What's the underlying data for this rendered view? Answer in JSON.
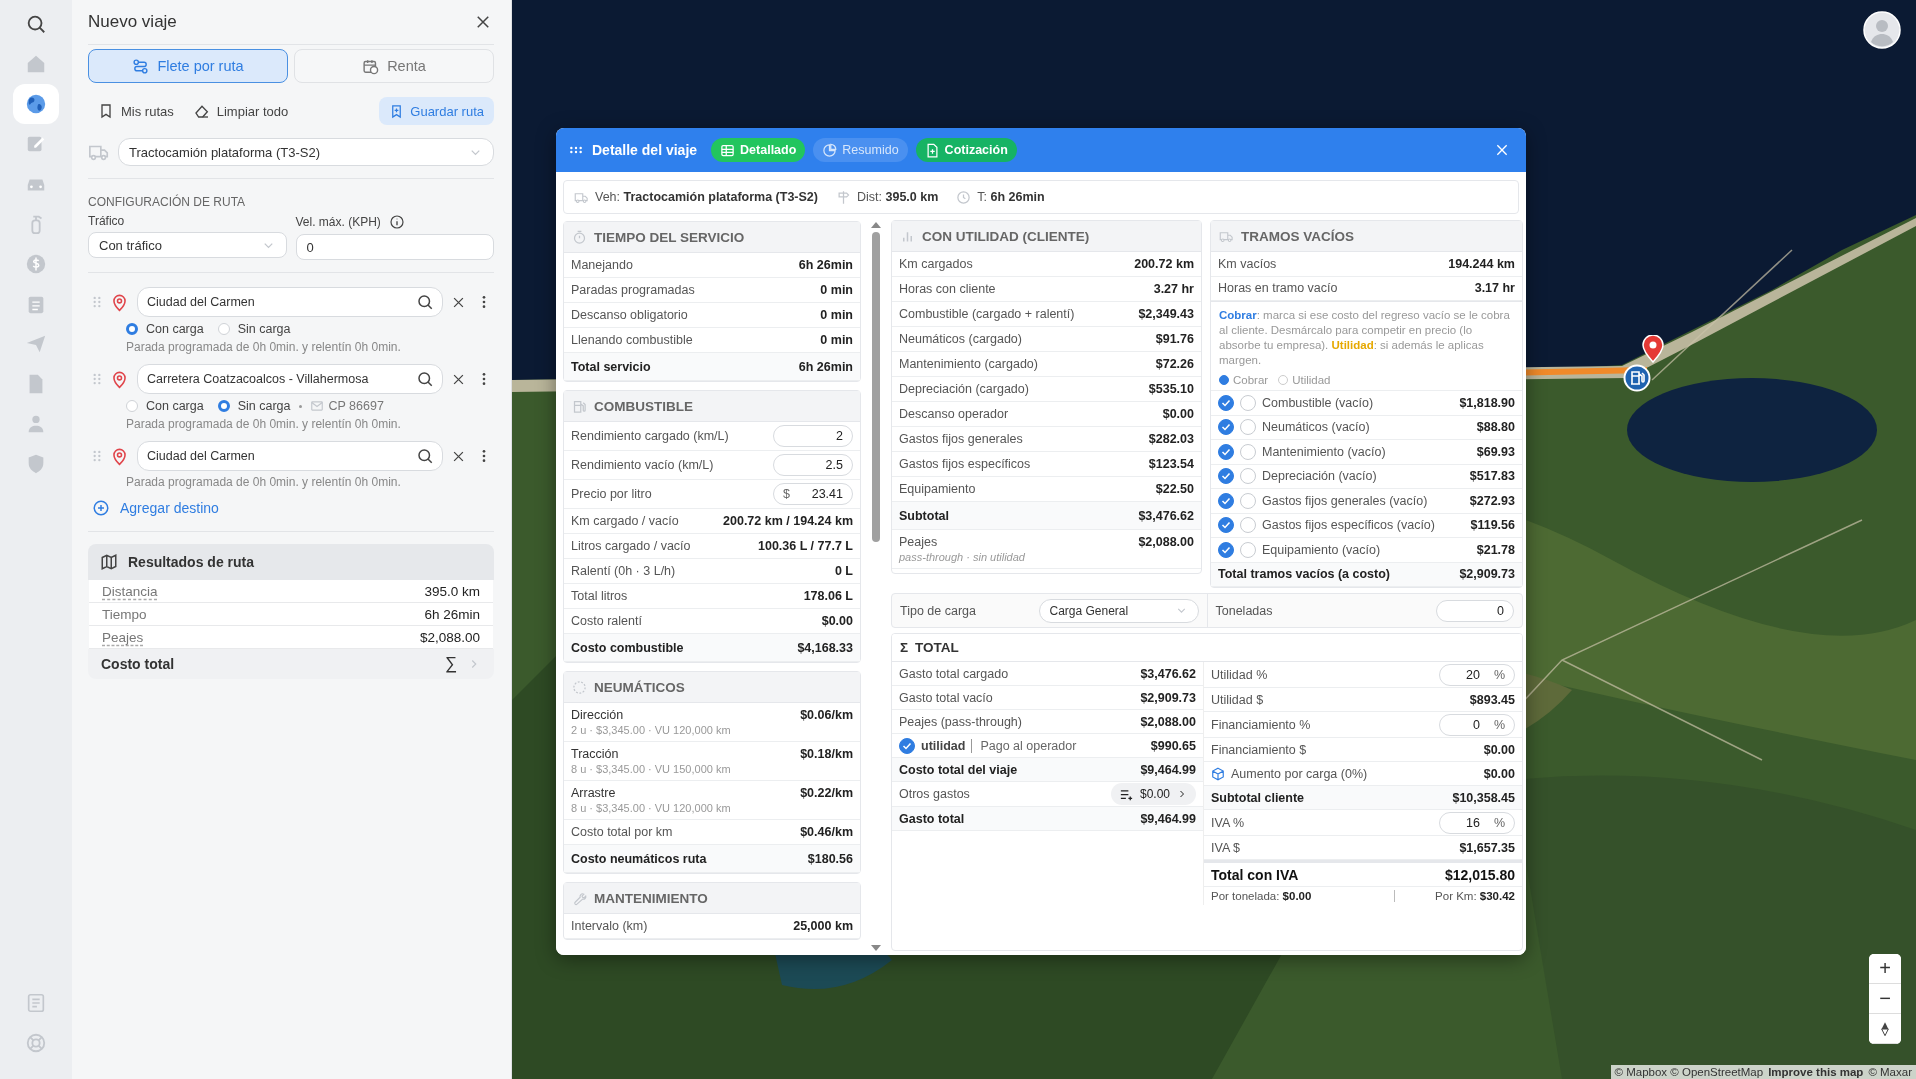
{
  "rail": {
    "top": [
      {
        "selected": false
      },
      {
        "selected": false
      },
      {
        "selected": true
      },
      {
        "selected": false
      },
      {
        "selected": false
      },
      {
        "selected": false
      },
      {
        "selected": false
      },
      {
        "selected": false
      },
      {
        "selected": false
      },
      {
        "selected": false
      },
      {
        "selected": false
      },
      {
        "selected": false
      }
    ],
    "bottom": [
      {
        "selected": false
      },
      {
        "selected": false
      }
    ]
  },
  "panel": {
    "title": "Nuevo viaje",
    "modes": [
      {
        "label": "Flete por ruta",
        "selected": true
      },
      {
        "label": "Renta",
        "selected": false
      }
    ],
    "actions": [
      "Mis rutas",
      "Limpiar todo"
    ],
    "save_button": "Guardar ruta",
    "vehicle": "Tractocamión plataforma (T3-S2)",
    "section_title": "CONFIGURACIÓN DE RUTA",
    "traffic": {
      "label": "Tráfico",
      "value": "Con tráfico"
    },
    "max_speed": {
      "label": "Vel. máx. (KPH)",
      "value": "0"
    },
    "stops": [
      {
        "value": "Ciudad del Carmen",
        "load_options": [
          {
            "label": "Con carga",
            "selected": true
          },
          {
            "label": "Sin carga",
            "selected": false
          }
        ],
        "note": "Parada programada de 0h 0min. y relentín 0h 0min."
      },
      {
        "value": "Carretera Coatzacoalcos - Villahermosa",
        "load_options": [
          {
            "label": "Con carga",
            "selected": false
          },
          {
            "label": "Sin carga",
            "selected": true
          }
        ],
        "postal_code": "CP 86697",
        "note": "Parada programada de 0h 0min. y relentín 0h 0min."
      },
      {
        "value": "Ciudad del Carmen",
        "note": "Parada programada de 0h 0min. y relentín 0h 0min."
      }
    ],
    "add_stop": "Agregar destino",
    "results": {
      "title": "Resultados de ruta",
      "rows": [
        {
          "label": "Distancia",
          "value": "395.0 km",
          "hint": true
        },
        {
          "label": "Tiempo",
          "value": "6h 26min",
          "hint": false
        },
        {
          "label": "Peajes",
          "value": "$2,088.00",
          "hint": true
        }
      ],
      "total_label": "Costo total",
      "symbol": "∑"
    }
  },
  "trip_detail": {
    "title": "Detalle del viaje",
    "views": [
      {
        "label": "Detallado",
        "selected": true
      },
      {
        "label": "Resumido",
        "selected": false
      }
    ],
    "quote_button": "Cotización",
    "summary": [
      {
        "label": "Veh:",
        "value": "Tractocamión plataforma (T3-S2)"
      },
      {
        "label": "Dist:",
        "value": "395.0 km"
      },
      {
        "label": "T:",
        "value": "6h 26min"
      }
    ],
    "left_sections": [
      {
        "title": "TIEMPO DEL SERVICIO",
        "rows": [
          {
            "kind": "row",
            "label": "Manejando",
            "value": "6h 26min"
          },
          {
            "kind": "row",
            "label": "Paradas programadas",
            "value": "0 min"
          },
          {
            "kind": "row",
            "label": "Descanso obligatorio",
            "value": "0 min"
          },
          {
            "kind": "row",
            "label": "Llenando combustible",
            "value": "0 min"
          },
          {
            "kind": "total",
            "label": "Total servicio",
            "value": "6h 26min"
          }
        ]
      },
      {
        "title": "COMBUSTIBLE",
        "rows": [
          {
            "kind": "input",
            "label": "Rendimiento cargado (km/L)",
            "value": "2"
          },
          {
            "kind": "input",
            "label": "Rendimiento vacío (km/L)",
            "value": "2.5"
          },
          {
            "kind": "input",
            "label": "Precio por litro",
            "value": "23.41",
            "prefix": "$"
          },
          {
            "kind": "row",
            "label": "Km cargado / vacío",
            "value": "200.72 km / 194.24 km"
          },
          {
            "kind": "row",
            "label": "Litros cargado / vacío",
            "value": "100.36 L / 77.7 L"
          },
          {
            "kind": "row",
            "label": "Ralentí (0h · 3 L/h)",
            "value": "0 L"
          },
          {
            "kind": "row",
            "label": "Total litros",
            "value": "178.06 L"
          },
          {
            "kind": "row",
            "label": "Costo ralentí",
            "value": "$0.00"
          },
          {
            "kind": "total",
            "label": "Costo combustible",
            "value": "$4,168.33"
          }
        ]
      },
      {
        "title": "NEUMÁTICOS",
        "rows": [
          {
            "kind": "detail",
            "label": "Dirección",
            "value": "$0.06/km",
            "sub": "2 u · $3,345.00 · VU 120,000 km"
          },
          {
            "kind": "detail",
            "label": "Tracción",
            "value": "$0.18/km",
            "sub": "8 u · $3,345.00 · VU 150,000 km"
          },
          {
            "kind": "detail",
            "label": "Arrastre",
            "value": "$0.22/km",
            "sub": "8 u · $3,345.00 · VU 120,000 km"
          },
          {
            "kind": "row",
            "label": "Costo total por km",
            "value": "$0.46/km"
          },
          {
            "kind": "total",
            "label": "Costo neumáticos ruta",
            "value": "$180.56"
          }
        ]
      },
      {
        "title": "MANTENIMIENTO",
        "rows": [
          {
            "kind": "row",
            "label": "Intervalo (km)",
            "value": "25,000 km"
          }
        ]
      }
    ],
    "client_card": {
      "title": "CON UTILIDAD (CLIENTE)",
      "rows": [
        {
          "kind": "row",
          "label": "Km cargados",
          "value": "200.72 km"
        },
        {
          "kind": "row",
          "label": "Horas con cliente",
          "value": "3.27 hr"
        },
        {
          "kind": "row",
          "label": "Combustible (cargado + ralentí)",
          "value": "$2,349.43"
        },
        {
          "kind": "row",
          "label": "Neumáticos (cargado)",
          "value": "$91.76"
        },
        {
          "kind": "row",
          "label": "Mantenimiento (cargado)",
          "value": "$72.26"
        },
        {
          "kind": "row",
          "label": "Depreciación (cargado)",
          "value": "$535.10"
        },
        {
          "kind": "row",
          "label": "Descanso operador",
          "value": "$0.00"
        },
        {
          "kind": "row",
          "label": "Gastos fijos generales",
          "value": "$282.03"
        },
        {
          "kind": "row",
          "label": "Gastos fijos específicos",
          "value": "$123.54"
        },
        {
          "kind": "row",
          "label": "Equipamiento",
          "value": "$22.50"
        },
        {
          "kind": "total",
          "label": "Subtotal",
          "value": "$3,476.62"
        },
        {
          "kind": "noted",
          "label": "Peajes",
          "value": "$2,088.00",
          "note": "pass-through · sin utilidad"
        }
      ]
    },
    "empty_legs": {
      "title": "TRAMOS VACÍOS",
      "rows": [
        {
          "kind": "row",
          "label": "Km vacíos",
          "value": "194.244 km"
        },
        {
          "kind": "row",
          "label": "Horas en tramo vacío",
          "value": "3.17 hr"
        }
      ],
      "note": "**Cobrar**: marca si ese costo del regreso vacío se le cobra al cliente. Desmárcalo para competir en precio (lo absorbe tu empresa). **Utilidad**: si además le aplicas margen.",
      "legend": [
        {
          "kind": "charge",
          "label": "Cobrar"
        },
        {
          "kind": "margin",
          "label": "Utilidad"
        }
      ],
      "items": [
        {
          "label": "Combustible (vacío)",
          "value": "$1,818.90",
          "charge": true,
          "margin": false
        },
        {
          "label": "Neumáticos (vacío)",
          "value": "$88.80",
          "charge": true,
          "margin": false
        },
        {
          "label": "Mantenimiento (vacío)",
          "value": "$69.93",
          "charge": true,
          "margin": false
        },
        {
          "label": "Depreciación (vacío)",
          "value": "$517.83",
          "charge": true,
          "margin": false
        },
        {
          "label": "Gastos fijos generales (vacío)",
          "value": "$272.93",
          "charge": true,
          "margin": false
        },
        {
          "label": "Gastos fijos específicos (vacío)",
          "value": "$119.56",
          "charge": true,
          "margin": false
        },
        {
          "label": "Equipamiento (vacío)",
          "value": "$21.78",
          "charge": true,
          "margin": false
        }
      ],
      "total": {
        "label": "Total tramos vacíos (a costo)",
        "value": "$2,909.73"
      }
    },
    "cargo_type": {
      "label": "Tipo de carga",
      "value": "Carga General"
    },
    "tonnage": {
      "label": "Toneladas",
      "value": "0"
    },
    "total_card": {
      "symbol": "Σ",
      "title": "TOTAL",
      "left_rows": [
        {
          "kind": "row",
          "label": "Gasto total cargado",
          "value": "$3,476.62"
        },
        {
          "kind": "row",
          "label": "Gasto total vacío",
          "value": "$2,909.73"
        },
        {
          "kind": "row",
          "label": "Peajes (pass-through)",
          "value": "$2,088.00"
        },
        {
          "kind": "check",
          "checked": true,
          "label": "utilidad",
          "detail": "Pago al operador",
          "value": "$990.65"
        },
        {
          "kind": "total",
          "label": "Costo total del viaje",
          "value": "$9,464.99"
        },
        {
          "kind": "button",
          "label": "Otros gastos",
          "value": "$0.00"
        },
        {
          "kind": "total",
          "label": "Gasto total",
          "value": "$9,464.99"
        }
      ],
      "right_rows": [
        {
          "kind": "input",
          "label": "Utilidad %",
          "value": "20",
          "suffix": "%"
        },
        {
          "kind": "row",
          "label": "Utilidad $",
          "value": "$893.45"
        },
        {
          "kind": "input",
          "label": "Financiamiento %",
          "value": "0",
          "suffix": "%"
        },
        {
          "kind": "row",
          "label": "Financiamiento $",
          "value": "$0.00"
        },
        {
          "kind": "icon",
          "label": "Aumento por carga (0%)",
          "value": "$0.00"
        },
        {
          "kind": "total",
          "label": "Subtotal cliente",
          "value": "$10,358.45"
        },
        {
          "kind": "input",
          "label": "IVA %",
          "value": "16",
          "suffix": "%"
        },
        {
          "kind": "row",
          "label": "IVA $",
          "value": "$1,657.35"
        },
        {
          "kind": "grand",
          "label": "Total con IVA",
          "value": "$12,015.80"
        }
      ],
      "footer": [
        {
          "label": "Por tonelada:",
          "value": "$0.00"
        },
        {
          "label": "Por Km:",
          "value": "$30.42"
        }
      ]
    }
  },
  "map": {
    "zoom_in": "+",
    "zoom_out": "−",
    "attribution": [
      "© Mapbox © OpenStreetMap",
      "Improve this map",
      "© Maxar"
    ]
  }
}
